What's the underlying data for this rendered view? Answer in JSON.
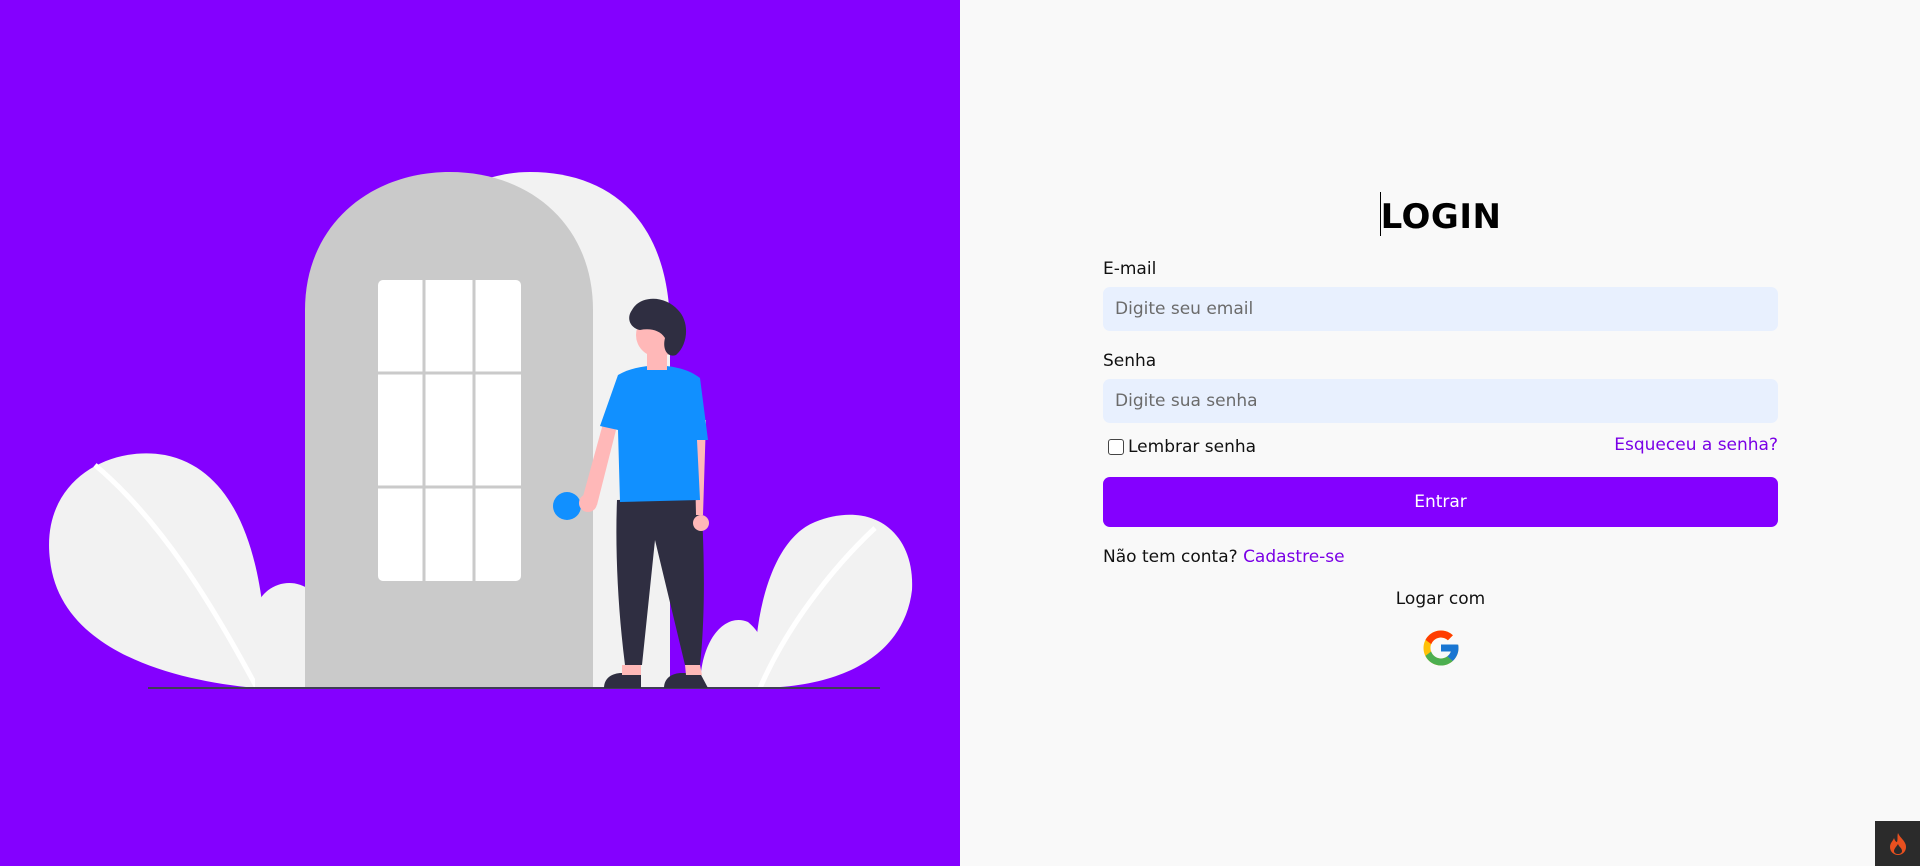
{
  "colors": {
    "brand": "#8400ff",
    "link": "#7a00e6",
    "input_bg": "#e8f0fe",
    "right_bg": "#f9f9f9"
  },
  "illustration": {
    "icon": "person-at-door-illustration"
  },
  "login": {
    "title": "LOGIN",
    "email": {
      "label": "E-mail",
      "placeholder": "Digite seu email",
      "value": ""
    },
    "password": {
      "label": "Senha",
      "placeholder": "Digite sua senha",
      "value": ""
    },
    "remember_label": "Lembrar senha",
    "remember_checked": false,
    "forgot_label": "Esqueceu a senha?",
    "submit_label": "Entrar",
    "signup_prompt": "Não tem conta?",
    "signup_link": "Cadastre-se",
    "social_label": "Logar com",
    "social_providers": [
      "google-icon"
    ]
  },
  "corner_widget": {
    "icon": "flame-icon"
  }
}
